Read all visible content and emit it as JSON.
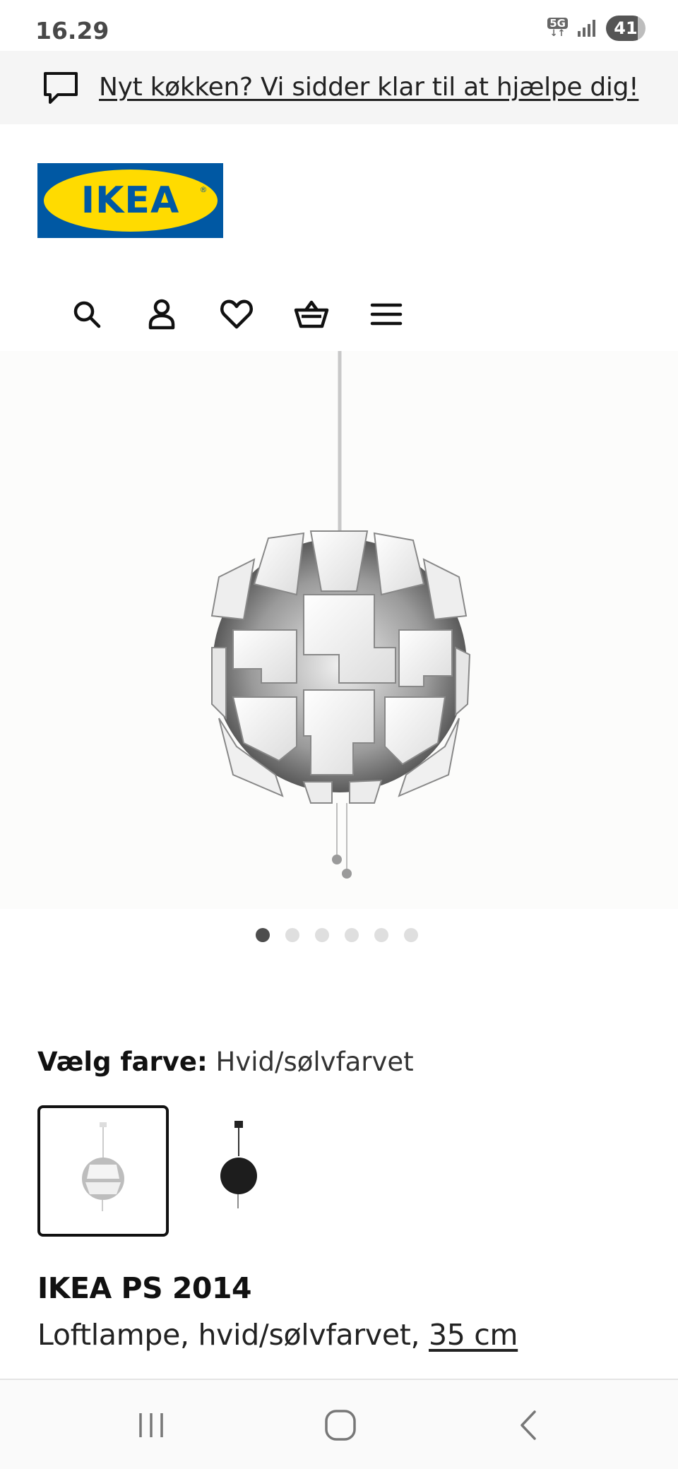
{
  "status_bar": {
    "time": "16.29",
    "network": "5G",
    "battery": "41"
  },
  "banner": {
    "link_text": "Nyt køkken? Vi sidder klar til at hjælpe dig!"
  },
  "logo": {
    "text": "IKEA",
    "brand_blue": "#0058a3",
    "brand_yellow": "#ffdb00"
  },
  "header_icons": [
    "search-icon",
    "account-icon",
    "heart-icon",
    "basket-icon",
    "menu-icon"
  ],
  "gallery": {
    "image_count": 6,
    "active_index": 0
  },
  "color_picker": {
    "label": "Vælg farve:",
    "selected_value": "Hvid/sølvfarvet",
    "options": [
      "white-silver",
      "black"
    ]
  },
  "product": {
    "name": "IKEA PS 2014",
    "description": "Loftlampe, hvid/sølvfarvet,",
    "size_link": "35 cm"
  },
  "system_nav": [
    "recent-apps-icon",
    "home-icon",
    "back-icon"
  ]
}
